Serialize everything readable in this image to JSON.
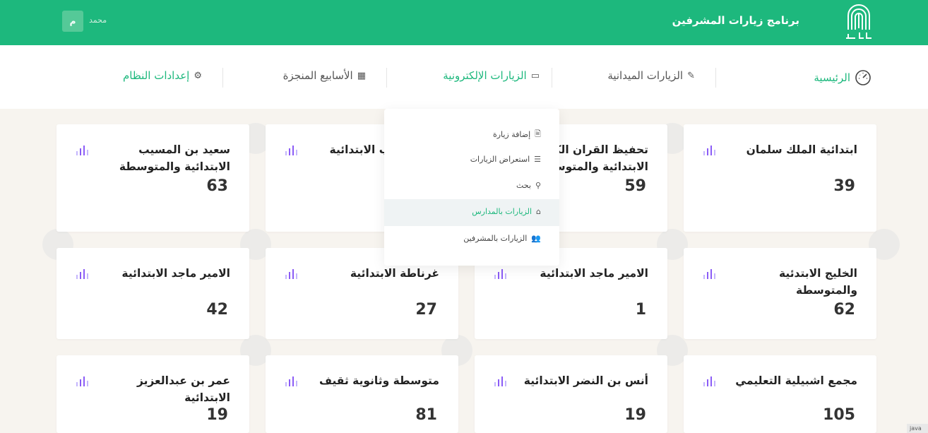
{
  "header": {
    "app_title": "برنامج زيارات المشرفين",
    "username": "محمد",
    "avatar_letter": "م"
  },
  "nav": {
    "home": "الرئيسية",
    "field_visits": "الزيارات الميدانية",
    "electronic_visits": "الزيارات الإلكترونية",
    "completed_weeks": "الأسابيع المنجزة",
    "system_settings": "إعدادات النظام"
  },
  "dropdown": {
    "items": [
      {
        "label": "إضافة زيارة",
        "icon": "edit-doc-icon"
      },
      {
        "label": "استعراض الزيارات",
        "icon": "list-icon"
      },
      {
        "label": "بحث",
        "icon": "search-icon"
      },
      {
        "label": "الزيارات بالمدارس",
        "icon": "school-icon",
        "active": true
      },
      {
        "label": "الزيارات بالمشرفين",
        "icon": "users-icon"
      }
    ]
  },
  "schools": [
    {
      "name": "ابتدائية الملك سلمان",
      "count": "39"
    },
    {
      "name": "تحفيظ القران الكريم الابتدائية والمتوسطة",
      "count": "59"
    },
    {
      "name": "عبدالمطلب الابتدائية",
      "count": ""
    },
    {
      "name": "سعيد بن المسيب الابتدائية والمتوسطة",
      "count": "63"
    },
    {
      "name": "الخليج الابتدئية والمتوسطة",
      "count": "62"
    },
    {
      "name": "الامير ماجد الابتدائية",
      "count": "1"
    },
    {
      "name": "غرناطة الابتدائية",
      "count": "27"
    },
    {
      "name": "الامير ماجد الابتدائية",
      "count": "42"
    },
    {
      "name": "مجمع اشبيلية التعليمي",
      "count": "105"
    },
    {
      "name": "أنس بن النضر الابتدائية",
      "count": "19"
    },
    {
      "name": "متوسطة وثانوية ثقيف",
      "count": "81"
    },
    {
      "name": "عمر بن عبدالعزيز الابتدائية",
      "count": "19"
    }
  ],
  "colors": {
    "brand_green": "#1db87d",
    "bar_purple": "#8b5cf6",
    "bar_light": "#c4b5fd"
  },
  "corner_text": "java"
}
